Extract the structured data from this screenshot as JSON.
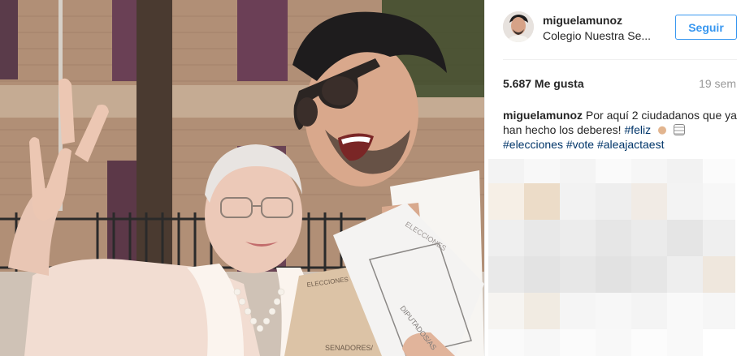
{
  "photo": {
    "envelope_text_1": "ELECCIONES",
    "envelope_text_2": "DIPUTADOS/AS",
    "envelope_text_3": "ELECCIONES",
    "envelope_text_4": "SENADORES/"
  },
  "post": {
    "username": "miguelamunoz",
    "location": "Colegio Nuestra Se...",
    "follow_label": "Seguir",
    "likes": "5.687 Me gusta",
    "time": "19 sem",
    "caption_user": "miguelamunoz",
    "caption_text_1": " Por aquí 2 ciudadanos que ya han hecho los deberes! ",
    "hashtag_1": "#feliz",
    "hashtag_2": "#elecciones",
    "hashtag_3": "#vote",
    "hashtag_4": "#aleajactaest"
  },
  "icons": {
    "hand_emoji": "ok-hand-icon",
    "ballot_emoji": "ballot-box-icon"
  },
  "colors": {
    "link": "#003569",
    "follow": "#3897f0",
    "muted": "#999999"
  }
}
